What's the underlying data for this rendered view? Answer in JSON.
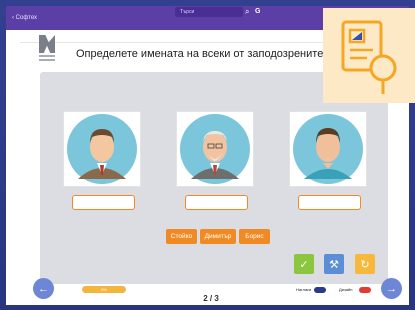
{
  "app": {
    "title": "‹ Софтех",
    "search_placeholder": "Търси"
  },
  "question": "Определете имената на всеки от заподозрените.",
  "suspects": [
    {
      "name": "suspect-1"
    },
    {
      "name": "suspect-2"
    },
    {
      "name": "suspect-3"
    }
  ],
  "name_chips": [
    "Стойко",
    "Димитър",
    "Борис"
  ],
  "progress": {
    "value": 0.0,
    "label": "0%"
  },
  "pager": {
    "label": "2 / 3"
  },
  "toggles": {
    "left": {
      "label": "Нагласи"
    },
    "right": {
      "label": "Дизайн"
    }
  },
  "colors": {
    "accent_orange": "#f08a24",
    "check_green": "#8cc63f",
    "tool_blue": "#5a8fd6",
    "retry_yellow": "#f6b93b",
    "topbar_purple": "#5b3fa6"
  }
}
